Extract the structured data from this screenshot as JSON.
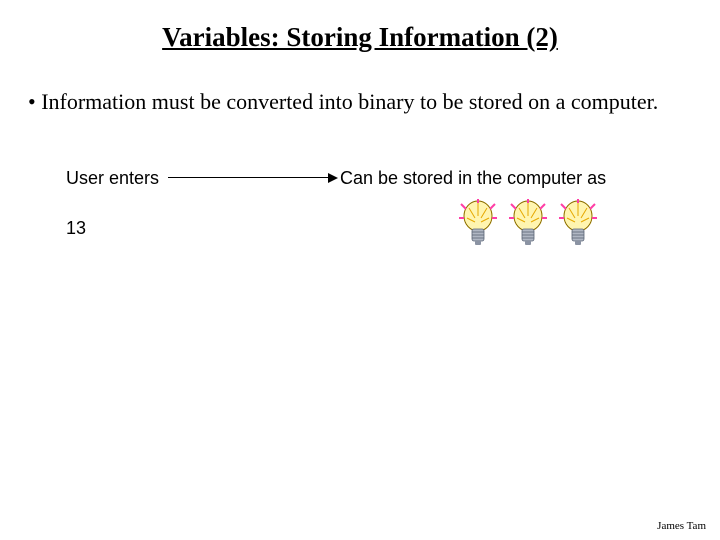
{
  "title": "Variables: Storing Information (2)",
  "bullet": {
    "marker": "•",
    "text": "Information must be converted into binary to be stored on a computer."
  },
  "diagram": {
    "user_enters_label": "User enters",
    "stored_as_label": "Can be stored in the computer as",
    "input_value": "13",
    "bulb_count": 3,
    "icon_semantic": "lightbulb-icon"
  },
  "footer": "James Tam"
}
